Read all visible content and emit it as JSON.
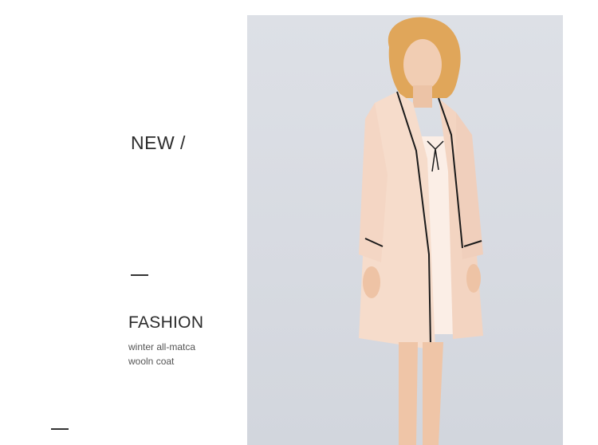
{
  "headline": {
    "new_label": "NEW /"
  },
  "section": {
    "title": "FASHION",
    "desc_line1": "winter all-matca",
    "desc_line2": "wooln coat"
  },
  "photo": {
    "background_color": "#dadde3",
    "robe_color": "#f6dccb",
    "trim_color": "#1a1a1a"
  }
}
